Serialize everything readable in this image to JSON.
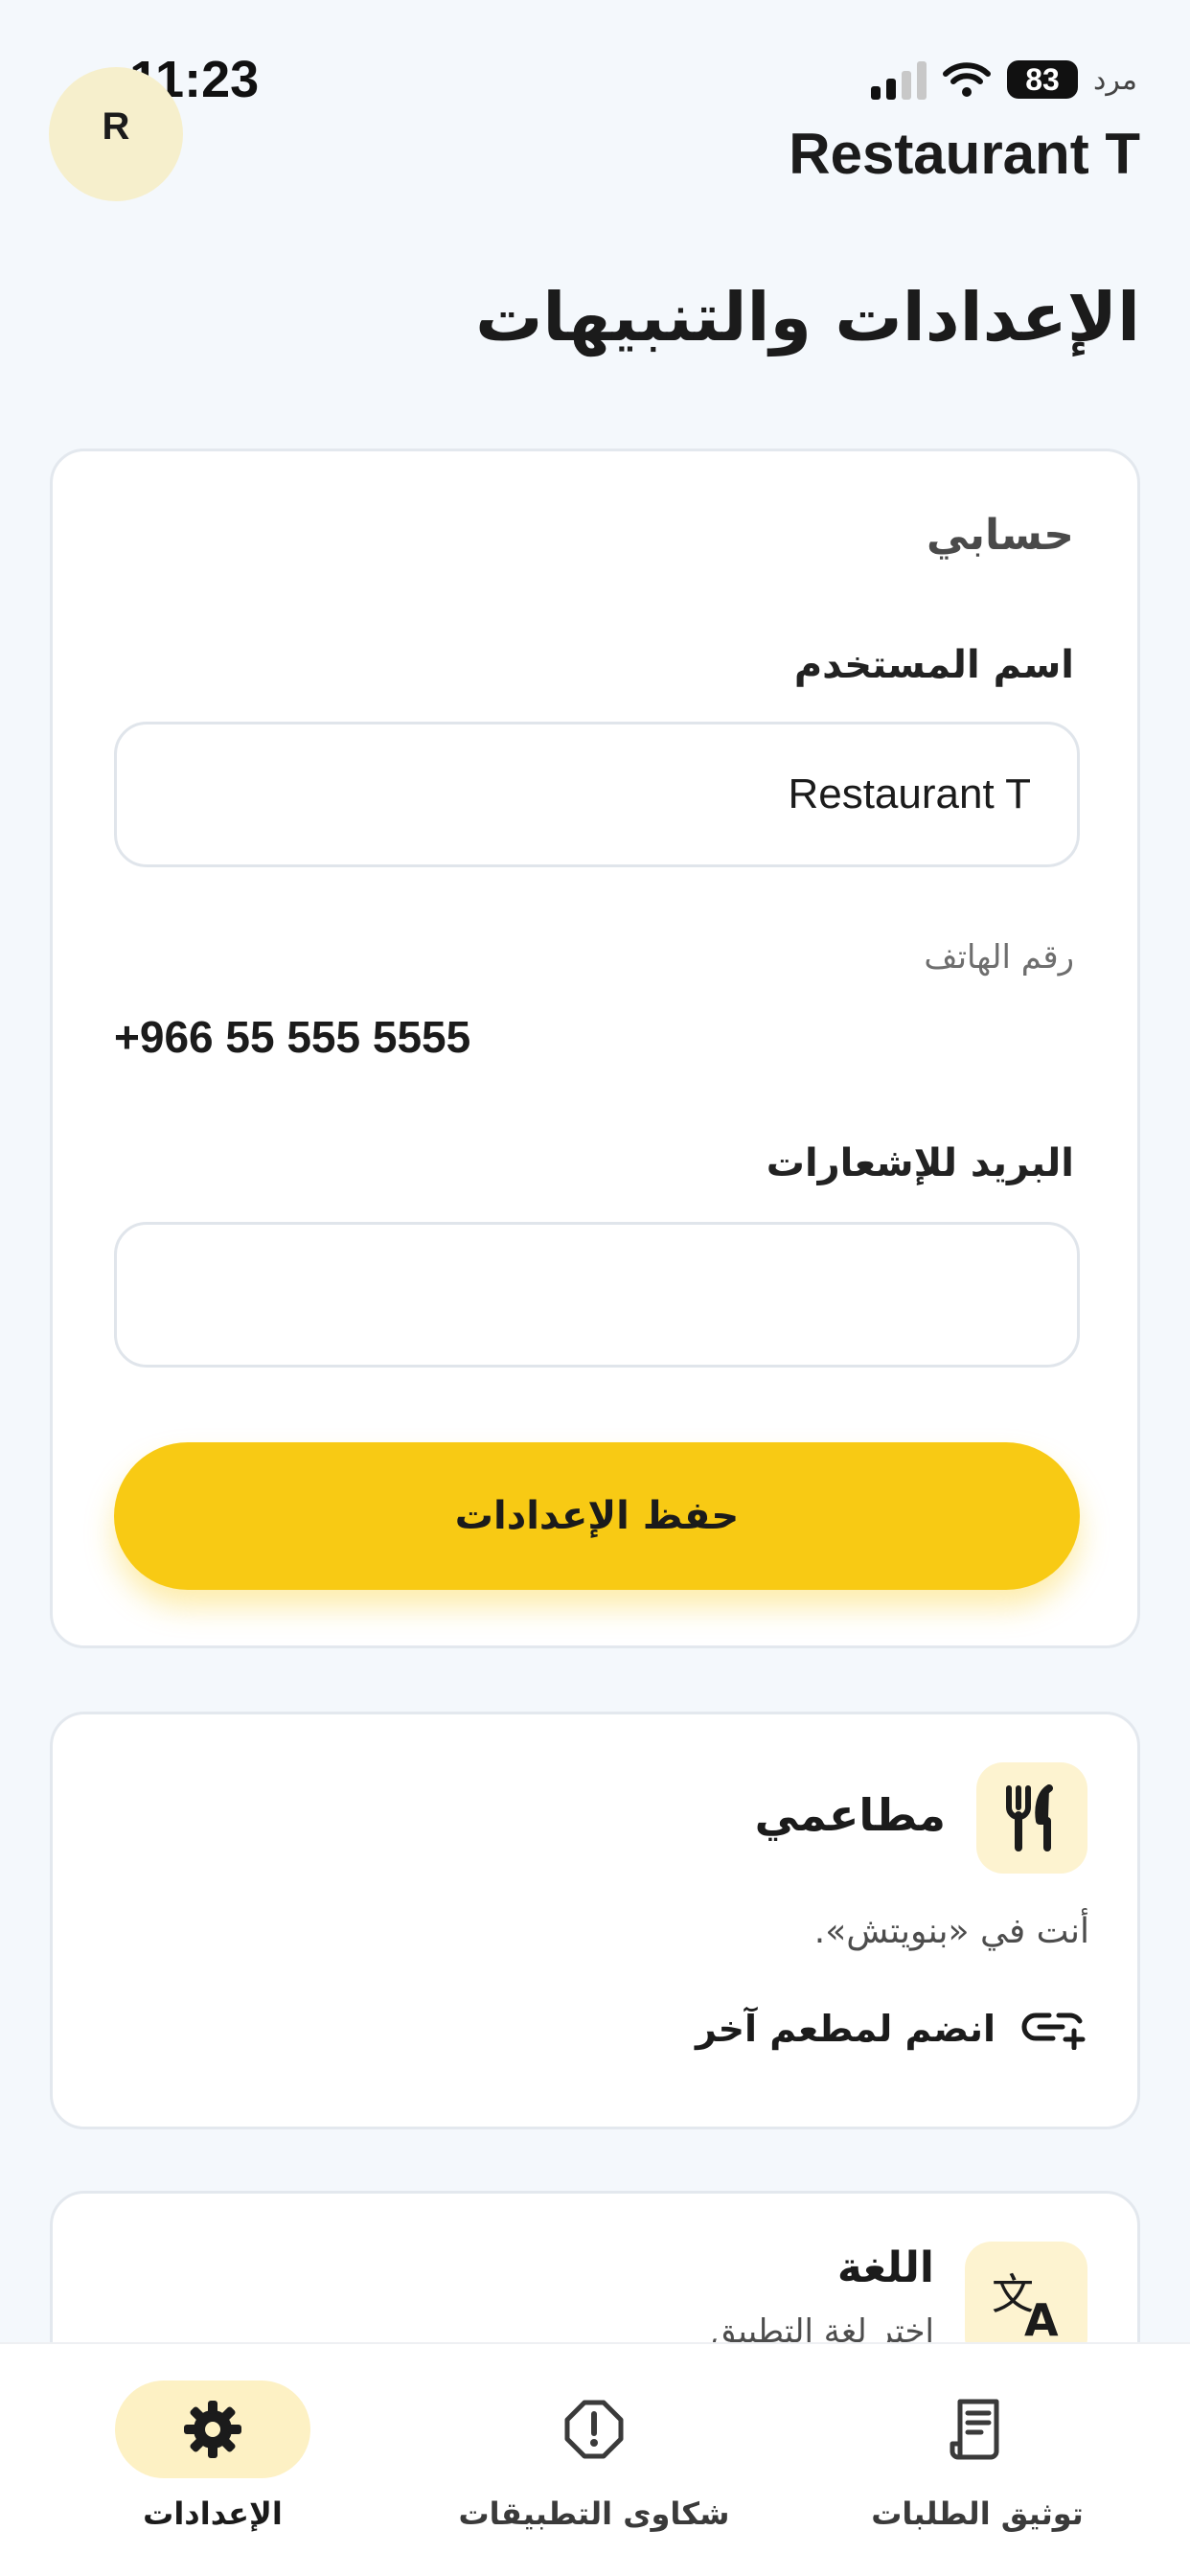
{
  "status_bar": {
    "time": "11:23",
    "carrier": "مرد",
    "battery": "83"
  },
  "header": {
    "avatar_initial": "R",
    "title": "Restaurant T"
  },
  "page_title": "الإعدادات والتنبيهات",
  "account": {
    "section_title": "حسابي",
    "username_label": "اسم المستخدم",
    "username_value": "Restaurant T",
    "phone_label": "رقم الهاتف",
    "phone_value": "+966 55 555 5555",
    "email_label": "البريد للإشعارات",
    "email_value": "",
    "save_label": "حفظ الإعدادات"
  },
  "restaurants": {
    "title": "مطاعمي",
    "description": "أنت في «بنويتش».",
    "join_label": "انضم لمطعم آخر",
    "icon": "fork-knife-icon"
  },
  "language": {
    "title": "اللغة",
    "subtitle": "اختر لغة التطبيق",
    "icon": "translate-icon"
  },
  "bottom_nav": {
    "items": [
      {
        "label": "الإعدادات",
        "icon": "gear-icon",
        "active": true
      },
      {
        "label": "شكاوى التطبيقات",
        "icon": "alert-icon",
        "active": false
      },
      {
        "label": "توثيق الطلبات",
        "icon": "receipt-icon",
        "active": false
      }
    ]
  },
  "colors": {
    "accent": "#f8ca14",
    "accent_soft": "#fdf1c4",
    "background": "#f4f8fc",
    "text": "#1b1b1b"
  }
}
